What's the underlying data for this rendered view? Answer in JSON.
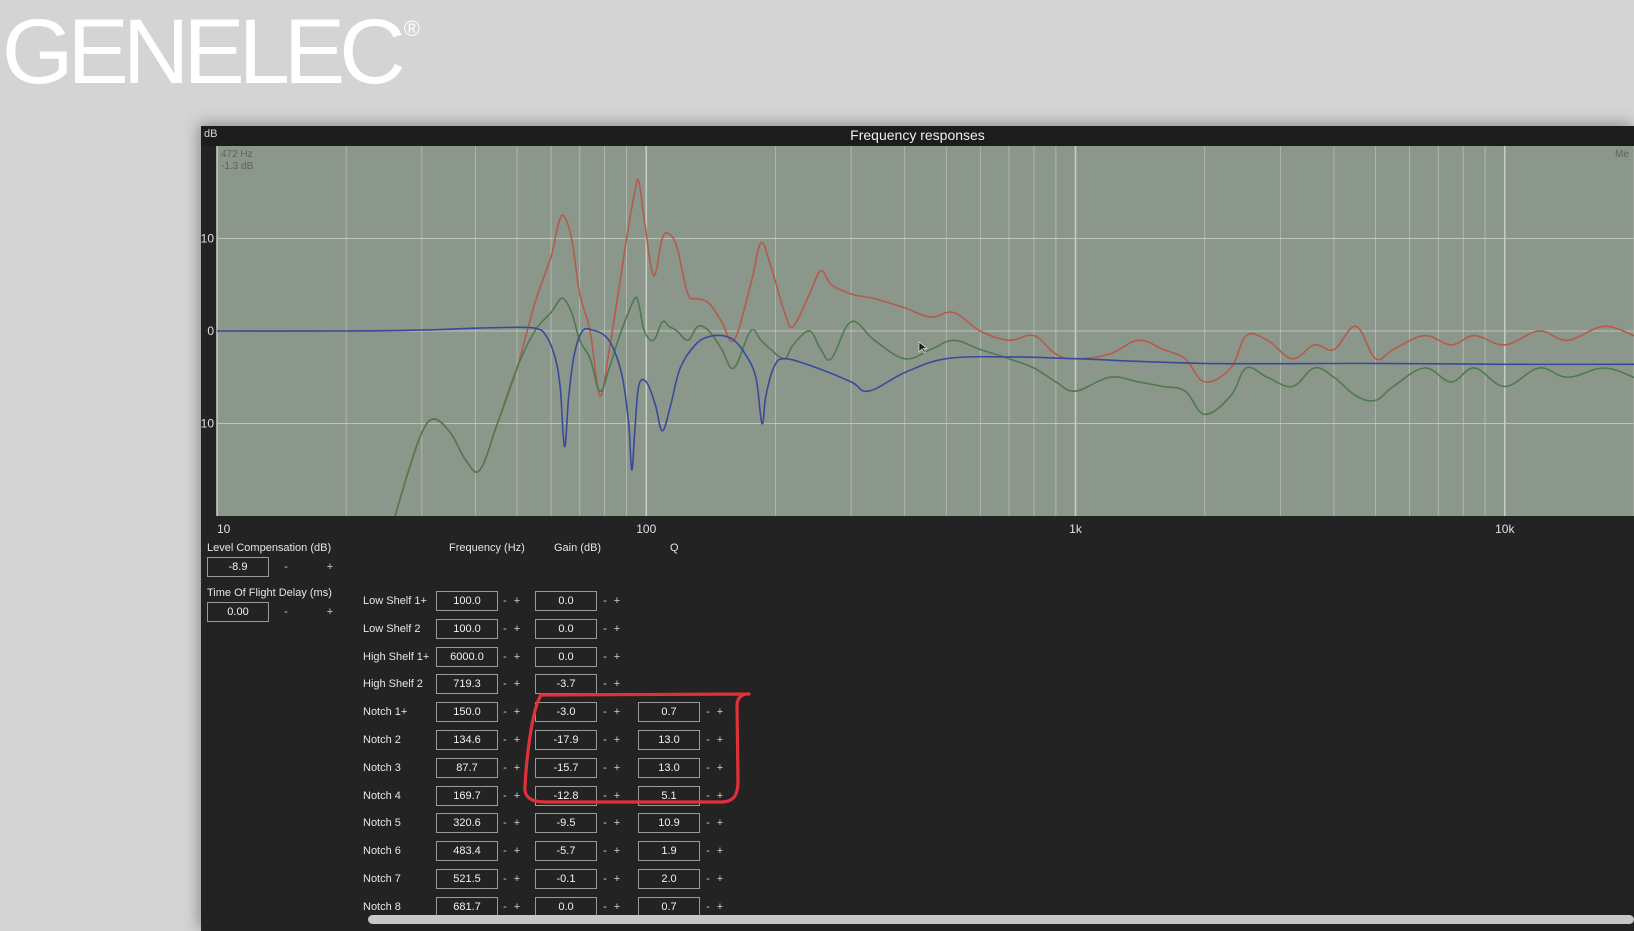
{
  "logo": {
    "text": "GENELEC",
    "mark": "®"
  },
  "chart": {
    "title": "Frequency responses",
    "y_unit": "dB",
    "cursor_freq": "472 Hz",
    "cursor_gain": "-1.3 dB",
    "corner_label": "Me",
    "y_ticks": [
      "10",
      "0",
      "-10"
    ],
    "x_ticks": [
      "10",
      "100",
      "1k",
      "10k"
    ]
  },
  "chart_data": {
    "type": "line",
    "xscale": "log",
    "xlim": [
      10,
      20000
    ],
    "ylim": [
      -20,
      20
    ],
    "grid": true,
    "x_ticks": [
      "10",
      "100",
      "1k",
      "10k"
    ],
    "y_ticks": [
      "10",
      "0",
      "-10"
    ],
    "series": [
      {
        "color": "#b65a4c",
        "points": [
          [
            26,
            -20
          ],
          [
            28,
            -15
          ],
          [
            30,
            -11
          ],
          [
            32,
            -9.5
          ],
          [
            35,
            -11
          ],
          [
            38,
            -14
          ],
          [
            41,
            -15
          ],
          [
            45,
            -10
          ],
          [
            50,
            -4
          ],
          [
            55,
            3
          ],
          [
            60,
            8
          ],
          [
            62,
            11
          ],
          [
            64,
            12.5
          ],
          [
            67,
            10
          ],
          [
            70,
            4
          ],
          [
            74,
            0
          ],
          [
            78,
            -7
          ],
          [
            82,
            -2
          ],
          [
            86,
            4
          ],
          [
            90,
            10
          ],
          [
            94,
            15
          ],
          [
            96,
            16.2
          ],
          [
            99,
            12
          ],
          [
            104,
            6
          ],
          [
            109,
            10
          ],
          [
            113,
            10.5
          ],
          [
            118,
            9
          ],
          [
            125,
            4
          ],
          [
            132,
            3.5
          ],
          [
            140,
            3
          ],
          [
            150,
            1
          ],
          [
            160,
            -1
          ],
          [
            175,
            5
          ],
          [
            185,
            9.5
          ],
          [
            195,
            7
          ],
          [
            210,
            2
          ],
          [
            220,
            0.5
          ],
          [
            240,
            4
          ],
          [
            255,
            6.5
          ],
          [
            270,
            5
          ],
          [
            300,
            4
          ],
          [
            340,
            3.5
          ],
          [
            400,
            2.5
          ],
          [
            460,
            1.5
          ],
          [
            520,
            2
          ],
          [
            600,
            0
          ],
          [
            700,
            -1
          ],
          [
            800,
            -0.5
          ],
          [
            900,
            -2.5
          ],
          [
            1000,
            -3
          ],
          [
            1200,
            -2.5
          ],
          [
            1400,
            -1
          ],
          [
            1600,
            -2
          ],
          [
            1800,
            -3
          ],
          [
            2000,
            -5.5
          ],
          [
            2300,
            -4
          ],
          [
            2500,
            -0.5
          ],
          [
            2800,
            -1
          ],
          [
            3200,
            -3
          ],
          [
            3600,
            -1.5
          ],
          [
            4000,
            -2
          ],
          [
            4500,
            0.5
          ],
          [
            5000,
            -3
          ],
          [
            5500,
            -2
          ],
          [
            6500,
            -0.5
          ],
          [
            7500,
            -1.5
          ],
          [
            8500,
            -0.5
          ],
          [
            10000,
            -1.5
          ],
          [
            12000,
            0
          ],
          [
            14000,
            -1
          ],
          [
            17000,
            0.5
          ],
          [
            20000,
            -0.5
          ]
        ]
      },
      {
        "color": "#4e7a4e",
        "points": [
          [
            26,
            -20
          ],
          [
            28,
            -15
          ],
          [
            30,
            -11
          ],
          [
            32,
            -9.5
          ],
          [
            35,
            -11
          ],
          [
            38,
            -14
          ],
          [
            41,
            -15
          ],
          [
            45,
            -10
          ],
          [
            50,
            -4
          ],
          [
            55,
            0
          ],
          [
            60,
            2
          ],
          [
            62,
            3
          ],
          [
            64,
            3.5
          ],
          [
            67,
            2
          ],
          [
            70,
            -1
          ],
          [
            74,
            -3
          ],
          [
            78,
            -6.5
          ],
          [
            82,
            -4
          ],
          [
            86,
            -1
          ],
          [
            90,
            1.5
          ],
          [
            94,
            3.5
          ],
          [
            96,
            3
          ],
          [
            99,
            0
          ],
          [
            104,
            -1
          ],
          [
            109,
            1
          ],
          [
            113,
            0.5
          ],
          [
            118,
            0
          ],
          [
            125,
            -1
          ],
          [
            132,
            0.5
          ],
          [
            140,
            0
          ],
          [
            150,
            -2
          ],
          [
            160,
            -4
          ],
          [
            175,
            0
          ],
          [
            185,
            -1
          ],
          [
            195,
            -2
          ],
          [
            210,
            -3
          ],
          [
            220,
            -1.5
          ],
          [
            240,
            0
          ],
          [
            255,
            -2
          ],
          [
            270,
            -3
          ],
          [
            300,
            1
          ],
          [
            340,
            -1
          ],
          [
            400,
            -3
          ],
          [
            460,
            -2
          ],
          [
            520,
            -1
          ],
          [
            600,
            -2
          ],
          [
            700,
            -3
          ],
          [
            800,
            -4
          ],
          [
            900,
            -5.5
          ],
          [
            1000,
            -6.5
          ],
          [
            1200,
            -5
          ],
          [
            1400,
            -5.5
          ],
          [
            1600,
            -6
          ],
          [
            1800,
            -6.5
          ],
          [
            2000,
            -9
          ],
          [
            2300,
            -7
          ],
          [
            2500,
            -4
          ],
          [
            2800,
            -5
          ],
          [
            3200,
            -6
          ],
          [
            3600,
            -4
          ],
          [
            4000,
            -5
          ],
          [
            4500,
            -7
          ],
          [
            5000,
            -7.5
          ],
          [
            5500,
            -6
          ],
          [
            6500,
            -4
          ],
          [
            7500,
            -5.5
          ],
          [
            8500,
            -4
          ],
          [
            10000,
            -6
          ],
          [
            12000,
            -4
          ],
          [
            14000,
            -5
          ],
          [
            17000,
            -4
          ],
          [
            20000,
            -5
          ]
        ]
      },
      {
        "color": "#3a4a9a",
        "points": [
          [
            10,
            0
          ],
          [
            20,
            0
          ],
          [
            30,
            0.1
          ],
          [
            40,
            0.3
          ],
          [
            50,
            0.4
          ],
          [
            55,
            0.3
          ],
          [
            58,
            -0.3
          ],
          [
            61,
            -2.5
          ],
          [
            63,
            -6
          ],
          [
            64.5,
            -12.5
          ],
          [
            66,
            -7
          ],
          [
            68,
            -2.5
          ],
          [
            71,
            0
          ],
          [
            75,
            0.1
          ],
          [
            80,
            -0.5
          ],
          [
            84,
            -2
          ],
          [
            88,
            -5
          ],
          [
            91,
            -10
          ],
          [
            92.5,
            -15
          ],
          [
            94,
            -11
          ],
          [
            96,
            -6
          ],
          [
            100,
            -5.5
          ],
          [
            105,
            -8
          ],
          [
            109,
            -10.8
          ],
          [
            114,
            -8
          ],
          [
            120,
            -4
          ],
          [
            130,
            -1.5
          ],
          [
            140,
            -0.6
          ],
          [
            150,
            -0.5
          ],
          [
            160,
            -1
          ],
          [
            170,
            -2.5
          ],
          [
            180,
            -5
          ],
          [
            186,
            -10
          ],
          [
            190,
            -7
          ],
          [
            198,
            -4
          ],
          [
            210,
            -3
          ],
          [
            250,
            -4
          ],
          [
            300,
            -5.5
          ],
          [
            330,
            -6.5
          ],
          [
            400,
            -4.5
          ],
          [
            500,
            -3
          ],
          [
            700,
            -2.8
          ],
          [
            1000,
            -3
          ],
          [
            2000,
            -3.5
          ],
          [
            5000,
            -3.5
          ],
          [
            10000,
            -3.6
          ],
          [
            20000,
            -3.6
          ]
        ]
      }
    ]
  },
  "level_compensation": {
    "label": "Level Compensation (dB)",
    "value": "-8.9",
    "minus": "-",
    "plus": "+"
  },
  "time_of_flight": {
    "label": "Time Of Flight Delay (ms)",
    "value": "0.00",
    "minus": "-",
    "plus": "+"
  },
  "columns": {
    "frequency": "Frequency (Hz)",
    "gain": "Gain (dB)",
    "q": "Q"
  },
  "filters": [
    {
      "name": "Low Shelf 1+",
      "freq": "100.0",
      "gain": "0.0",
      "q": null
    },
    {
      "name": "Low Shelf 2",
      "freq": "100.0",
      "gain": "0.0",
      "q": null
    },
    {
      "name": "High Shelf 1+",
      "freq": "6000.0",
      "gain": "0.0",
      "q": null
    },
    {
      "name": "High Shelf 2",
      "freq": "719.3",
      "gain": "-3.7",
      "q": null
    },
    {
      "name": "Notch 1+",
      "freq": "150.0",
      "gain": "-3.0",
      "q": "0.7"
    },
    {
      "name": "Notch 2",
      "freq": "134.6",
      "gain": "-17.9",
      "q": "13.0"
    },
    {
      "name": "Notch 3",
      "freq": "87.7",
      "gain": "-15.7",
      "q": "13.0"
    },
    {
      "name": "Notch 4",
      "freq": "169.7",
      "gain": "-12.8",
      "q": "5.1"
    },
    {
      "name": "Notch 5",
      "freq": "320.6",
      "gain": "-9.5",
      "q": "10.9"
    },
    {
      "name": "Notch 6",
      "freq": "483.4",
      "gain": "-5.7",
      "q": "1.9"
    },
    {
      "name": "Notch 7",
      "freq": "521.5",
      "gain": "-0.1",
      "q": "2.0"
    },
    {
      "name": "Notch 8",
      "freq": "681.7",
      "gain": "0.0",
      "q": "0.7"
    }
  ],
  "stepper": {
    "minus": "-",
    "plus": "+"
  },
  "colors": {
    "plot_bg": "#8c978b",
    "grid": "#c8cfc6",
    "annotation": "#e0303a",
    "window_bg": "#232323"
  }
}
